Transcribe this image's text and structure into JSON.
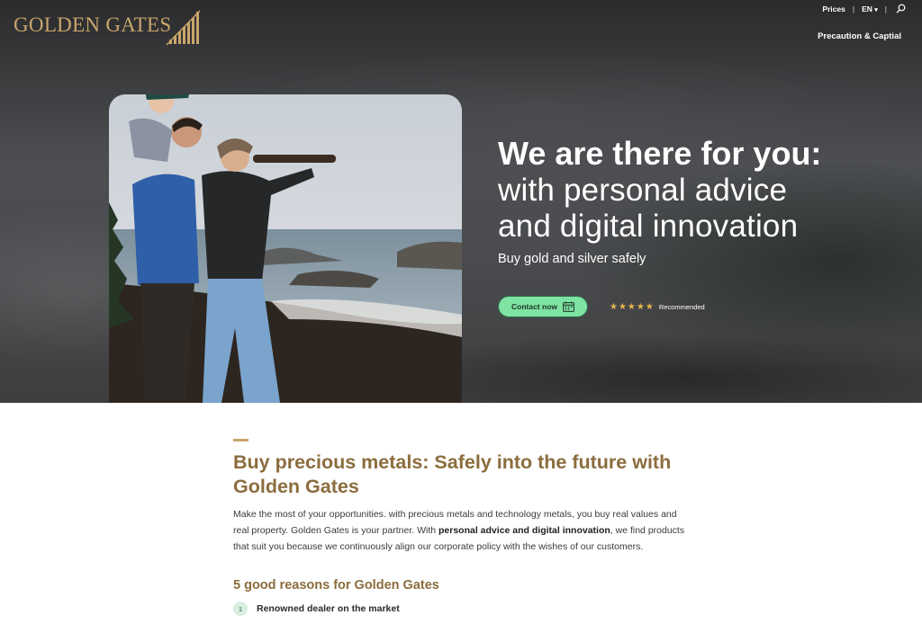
{
  "brand": {
    "name": "GOLDEN GATES",
    "color": "#c9a66b"
  },
  "topnav": {
    "prices": "Prices",
    "sep": "|",
    "language": "EN",
    "language_caret": "▾"
  },
  "subnav": {
    "precaution": "Precaution & Captial"
  },
  "hero": {
    "headline_bold": "We are there for you:",
    "headline_line2": "with personal advice",
    "headline_line3": "and digital innovation",
    "tagline": "Buy gold and silver safely",
    "cta_label": "Contact now",
    "stars": "★★★★★",
    "recommended": "Recommended"
  },
  "main": {
    "heading": "Buy precious metals: Safely into the future with Golden Gates",
    "intro_part1": "Make the most of your opportunities. with precious metals and technology metals, you buy real values and real property. Golden Gates is your partner. With ",
    "intro_bold": "personal advice and digital innovation",
    "intro_part2": ", we find products that suit you because we continuously align our corporate policy with the wishes of our customers.",
    "reasons_heading": "5 good reasons for Golden Gates",
    "reasons": [
      {
        "number": "1",
        "label": "Renowned dealer on the market"
      }
    ]
  },
  "colors": {
    "accent_gold": "#c9a66b",
    "heading_brown": "#8b6d3d",
    "cta_green": "#7ee3a3",
    "star_gold": "#e7b54b"
  }
}
